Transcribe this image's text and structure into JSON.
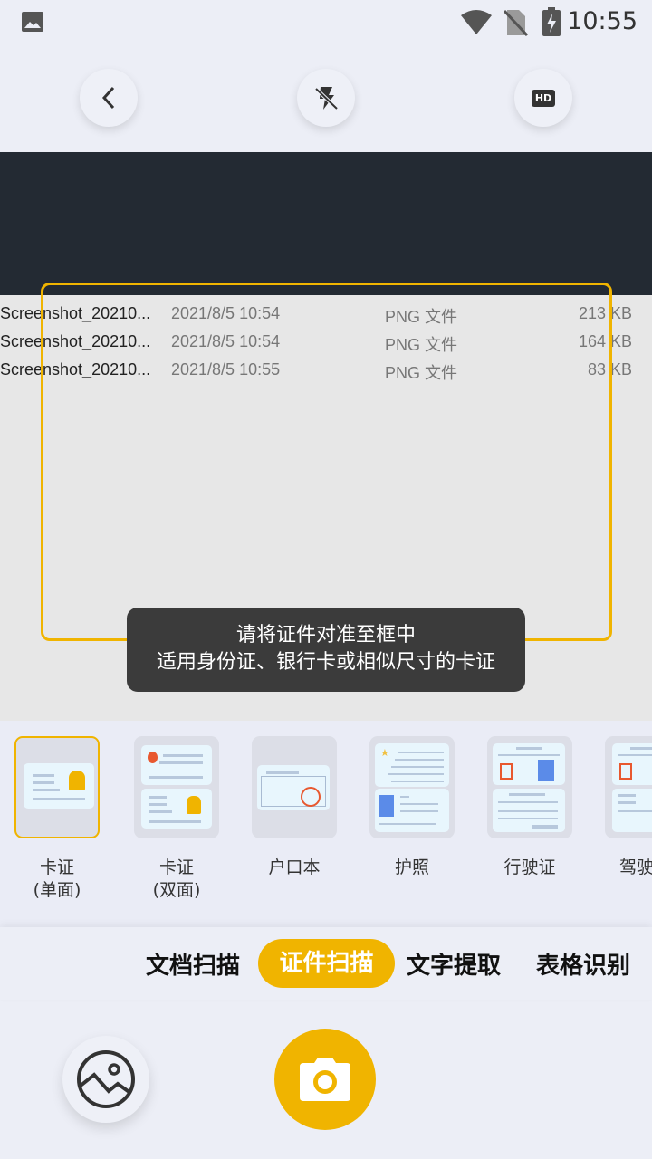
{
  "status_bar": {
    "time": "10:55",
    "icons": [
      "image-icon",
      "wifi-icon",
      "no-sim-icon",
      "battery-charging-icon"
    ]
  },
  "top_bar": {
    "back": "back-icon",
    "flash": "flash-off-icon",
    "hd": "HD"
  },
  "preview": {
    "rows": [
      {
        "name": "Screenshot_20210...",
        "date": "2021/8/5 10:54",
        "type": "PNG 文件",
        "size": "213 KB"
      },
      {
        "name": "Screenshot_20210...",
        "date": "2021/8/5 10:54",
        "type": "PNG 文件",
        "size": "164 KB"
      },
      {
        "name": "Screenshot_20210...",
        "date": "2021/8/5 10:55",
        "type": "PNG 文件",
        "size": "83 KB"
      }
    ]
  },
  "frame_color": "#f0b400",
  "toast": {
    "line1": "请将证件对准至框中",
    "line2": "适用身份证、银行卡或相似尺寸的卡证"
  },
  "doc_types": [
    {
      "label": "卡证\n(单面)",
      "selected": true
    },
    {
      "label": "卡证\n(双面)"
    },
    {
      "label": "户口本"
    },
    {
      "label": "护照"
    },
    {
      "label": "行驶证"
    },
    {
      "label": "驾驶证"
    }
  ],
  "modes": {
    "items": [
      "文档扫描",
      "证件扫描",
      "文字提取",
      "表格识别"
    ],
    "active": "证件扫描"
  },
  "bottom": {
    "gallery": "gallery-icon",
    "shutter": "camera-icon"
  },
  "accent": "#f0b400"
}
